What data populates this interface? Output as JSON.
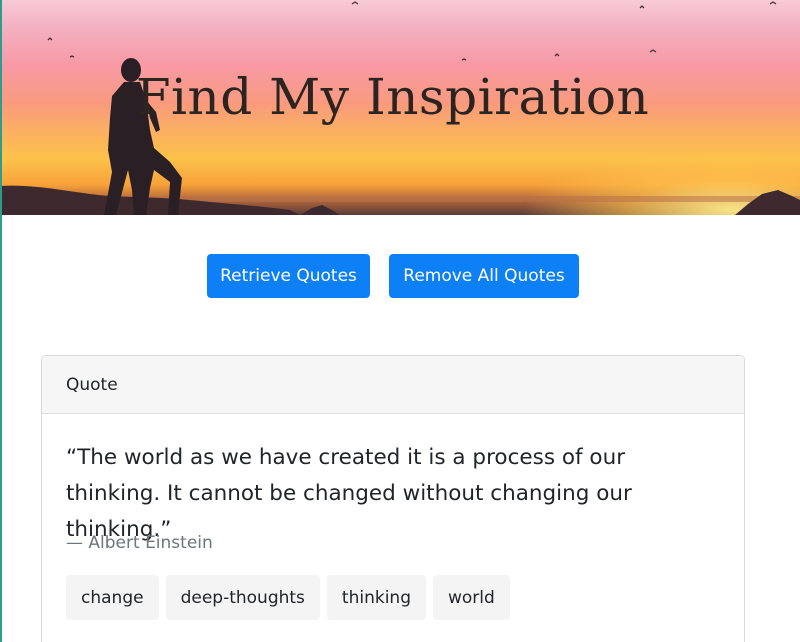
{
  "hero": {
    "title": "Find My Inspiration"
  },
  "actions": {
    "retrieve_label": "Retrieve Quotes",
    "remove_label": "Remove All Quotes"
  },
  "quote_card": {
    "header": "Quote",
    "text": "“The world as we have created it is a process of our thinking. It cannot be changed without changing our thinking.”",
    "author": "— Albert Einstein",
    "tags": [
      "change",
      "deep-thoughts",
      "thinking",
      "world"
    ]
  },
  "colors": {
    "primary_button": "#0d7ff7",
    "author_text": "#6c757d",
    "tag_background": "#f4f4f4"
  }
}
